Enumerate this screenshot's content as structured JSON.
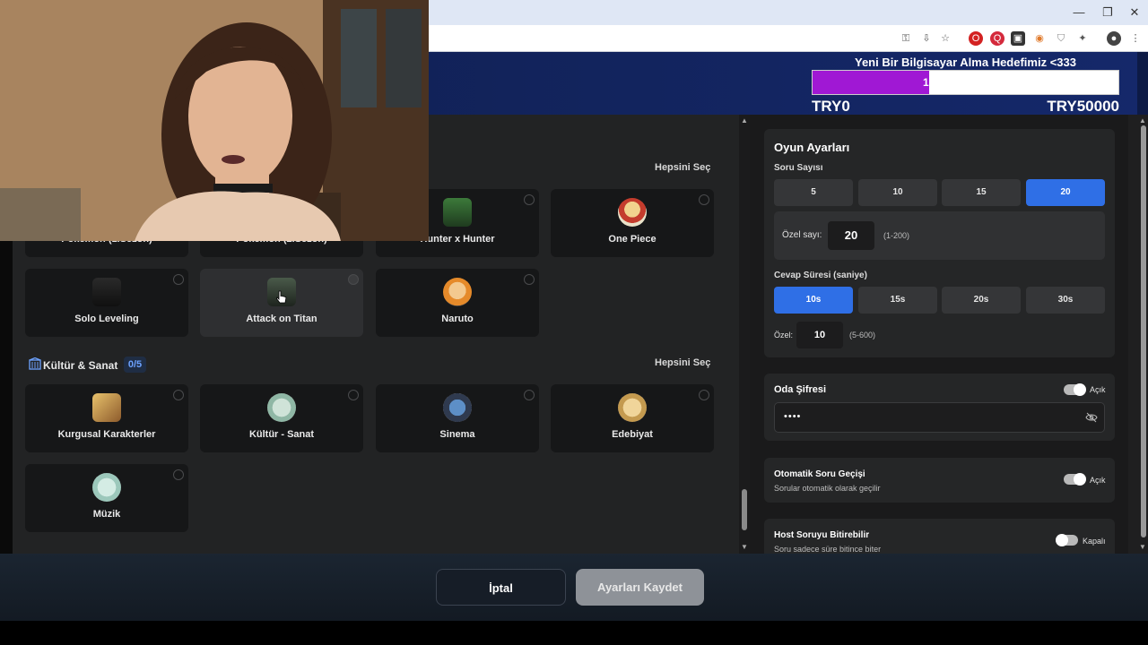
{
  "banner": {
    "title": "Yeni Bir Bilgisayar Alma Hedefimiz <333",
    "progress_value": "1",
    "progress_fraction": 0.38,
    "min_label": "TRY0",
    "max_label": "TRY50000"
  },
  "categories": {
    "anime_select_all": "Hepsini Seç",
    "anime_cards": [
      {
        "label": "Pokémon (1.Sezon)",
        "icon": "pokemon-icon"
      },
      {
        "label": "Pokémon (2.Sezon)",
        "icon": "pokemon-icon"
      },
      {
        "label": "Hunter x Hunter",
        "icon": "hunter-x-hunter-icon"
      },
      {
        "label": "One Piece",
        "icon": "one-piece-icon"
      },
      {
        "label": "Solo Leveling",
        "icon": "solo-leveling-icon"
      },
      {
        "label": "Attack on Titan",
        "icon": "attack-on-titan-icon"
      },
      {
        "label": "Naruto",
        "icon": "naruto-icon"
      }
    ],
    "culture": {
      "title": "Kültür & Sanat",
      "count": "0/5",
      "select_all": "Hepsini Seç",
      "cards": [
        {
          "label": "Kurgusal Karakterler",
          "icon": "toy-characters-icon"
        },
        {
          "label": "Kültür - Sanat",
          "icon": "culture-art-icon"
        },
        {
          "label": "Sinema",
          "icon": "cinema-icon"
        },
        {
          "label": "Edebiyat",
          "icon": "literature-icon"
        },
        {
          "label": "Müzik",
          "icon": "music-icon"
        }
      ]
    }
  },
  "settings": {
    "title": "Oyun Ayarları",
    "question_count_label": "Soru Sayısı",
    "question_counts": [
      "5",
      "10",
      "15",
      "20"
    ],
    "question_count_selected": "20",
    "custom_count_label": "Özel sayı:",
    "custom_count_value": "20",
    "custom_count_range": "(1-200)",
    "answer_time_label": "Cevap Süresi (saniye)",
    "answer_times": [
      "10s",
      "15s",
      "20s",
      "30s"
    ],
    "answer_time_selected": "10s",
    "custom_time_label": "Özel:",
    "custom_time_value": "10",
    "custom_time_range": "(5-600)"
  },
  "password": {
    "title": "Oda Şifresi",
    "toggle_label": "Açık",
    "value": "••••"
  },
  "auto_next": {
    "title": "Otomatik Soru Geçişi",
    "description": "Sorular otomatik olarak geçilir",
    "toggle_label": "Açık"
  },
  "host_end": {
    "title": "Host Soruyu Bitirebilir",
    "description": "Soru sadece süre bitince biter",
    "toggle_label": "Kapalı"
  },
  "footer": {
    "cancel_label": "İptal",
    "save_label": "Ayarları Kaydet"
  },
  "colors": {
    "accent": "#2f6fe6",
    "progress": "#a018d4",
    "banner": "#15286a"
  }
}
